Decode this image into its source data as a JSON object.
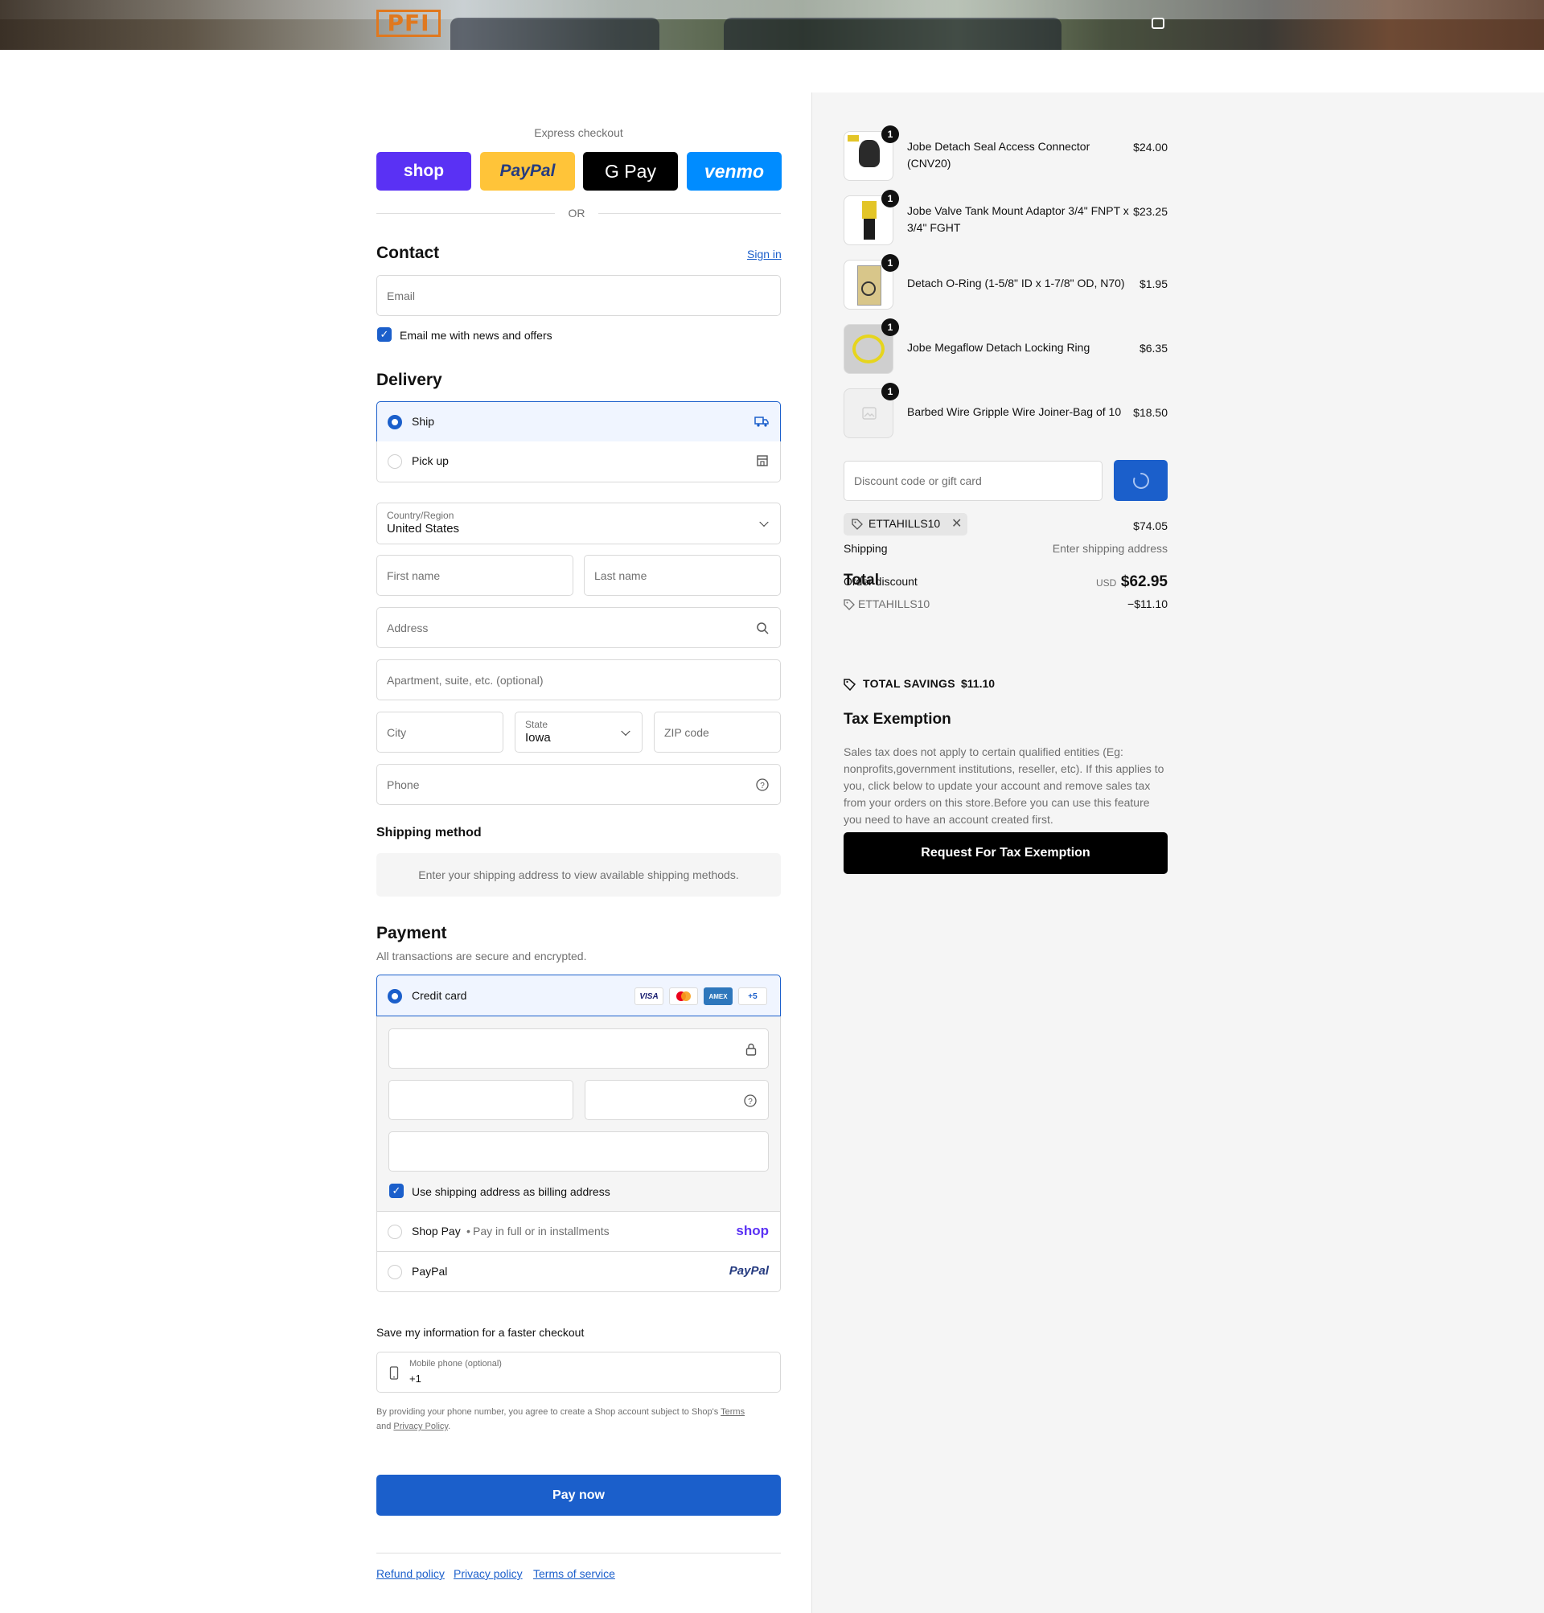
{
  "header": {
    "logo_text": "PFI"
  },
  "express": {
    "label": "Express checkout",
    "buttons": [
      "shop",
      "PayPal",
      "G Pay",
      "venmo"
    ],
    "or_label": "OR"
  },
  "contact": {
    "title": "Contact",
    "sign_in": "Sign in",
    "email_placeholder": "Email",
    "news_label": "Email me with news and offers"
  },
  "delivery": {
    "title": "Delivery",
    "options": [
      {
        "label": "Ship",
        "selected": true,
        "icon": "truck-icon"
      },
      {
        "label": "Pick up",
        "selected": false,
        "icon": "store-icon"
      }
    ],
    "country_label": "Country/Region",
    "country_value": "United States",
    "first_name": "First name",
    "last_name": "Last name",
    "address": "Address",
    "apartment": "Apartment, suite, etc. (optional)",
    "city": "City",
    "state_label": "State",
    "state_value": "Iowa",
    "zip": "ZIP code",
    "phone": "Phone"
  },
  "shipping_method": {
    "title": "Shipping method",
    "notice": "Enter your shipping address to view available shipping methods."
  },
  "payment": {
    "title": "Payment",
    "subtitle": "All transactions are secure and encrypted.",
    "credit_card_label": "Credit card",
    "card_brands": [
      "VISA",
      "MC",
      "AMEX",
      "+5"
    ],
    "billing_same_label": "Use shipping address as billing address",
    "shop_pay_label": "Shop Pay",
    "shop_pay_sub": "Pay in full or in installments",
    "shop_pay_logo": "shop",
    "paypal_label": "PayPal",
    "paypal_logo": "PayPal"
  },
  "save_info": {
    "title": "Save my information for a faster checkout",
    "mobile_label": "Mobile phone (optional)",
    "mobile_value": "+1",
    "legal_text": "By providing your phone number, you agree to create a Shop account subject to Shop's",
    "terms": "Terms",
    "and": "and",
    "privacy": "Privacy Policy",
    "period": "."
  },
  "pay_now": "Pay now",
  "footer_links": [
    "Refund policy",
    "Privacy policy",
    "Terms of service"
  ],
  "cart": {
    "items": [
      {
        "name": "Jobe Detach Seal Access Connector (CNV20)",
        "price": "$24.00",
        "qty": "1"
      },
      {
        "name": "Jobe Valve Tank Mount Adaptor 3/4\" FNPT x 3/4\" FGHT",
        "price": "$23.25",
        "qty": "1"
      },
      {
        "name": "Detach O-Ring (1-5/8\" ID x 1-7/8\" OD, N70)",
        "price": "$1.95",
        "qty": "1"
      },
      {
        "name": "Jobe Megaflow Detach Locking Ring",
        "price": "$6.35",
        "qty": "1"
      },
      {
        "name": "Barbed Wire Gripple Wire Joiner-Bag of 10",
        "price": "$18.50",
        "qty": "1"
      }
    ],
    "discount_placeholder": "Discount code or gift card",
    "applied_code": "ETTAHILLS10",
    "subtotal_value": "$74.05",
    "shipping_label": "Shipping",
    "shipping_value": "Enter shipping address",
    "total_label": "Total",
    "order_discount_label": "Order discount",
    "currency": "USD",
    "total_value": "$62.95",
    "discount_code_row": "ETTAHILLS10",
    "discount_value": "−$11.10",
    "savings_label": "TOTAL SAVINGS",
    "savings_value": "$11.10"
  },
  "tax": {
    "title": "Tax Exemption",
    "body": "Sales tax does not apply to certain qualified entities (Eg: nonprofits,government institutions, reseller, etc). If this applies to you, click below to update your account and remove sales tax from your orders on this store.Before you can use this feature you need to have an account created first.",
    "button": "Request For Tax Exemption"
  },
  "colors": {
    "accent": "#1b5fcb",
    "shop_purple": "#5a31f4",
    "paypal_yellow": "#ffc439",
    "venmo_blue": "#008cff"
  }
}
